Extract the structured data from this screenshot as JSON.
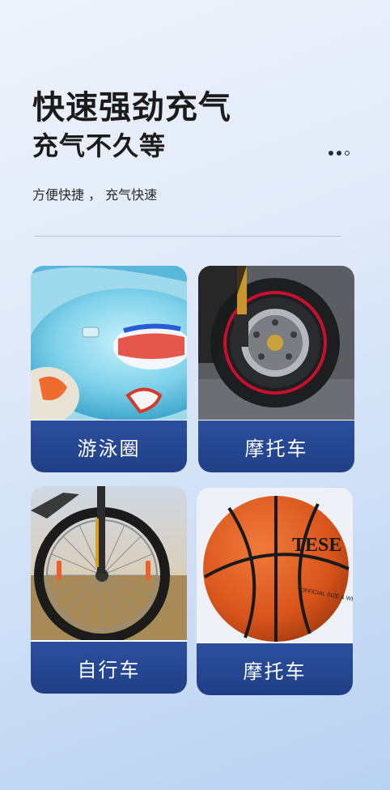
{
  "header": {
    "title_line1": "快速强劲充气",
    "title_line2": "充气不久等",
    "subtitle": "方便快捷 ， 充气快速"
  },
  "cards": [
    {
      "label": "游泳圈",
      "icon": "swim-ring"
    },
    {
      "label": "摩托车",
      "icon": "motorcycle-wheel"
    },
    {
      "label": "自行车",
      "icon": "bicycle-wheel"
    },
    {
      "label": "摩托车",
      "icon": "basketball"
    }
  ],
  "basketball_text": {
    "brand": "TESE",
    "small": "OFFICIAL SIZE & WEIGHT"
  },
  "colors": {
    "label_bg": "#23448e",
    "ring": "#7fd1ea",
    "rim": "#c8102e",
    "ball": "#d9541c"
  }
}
